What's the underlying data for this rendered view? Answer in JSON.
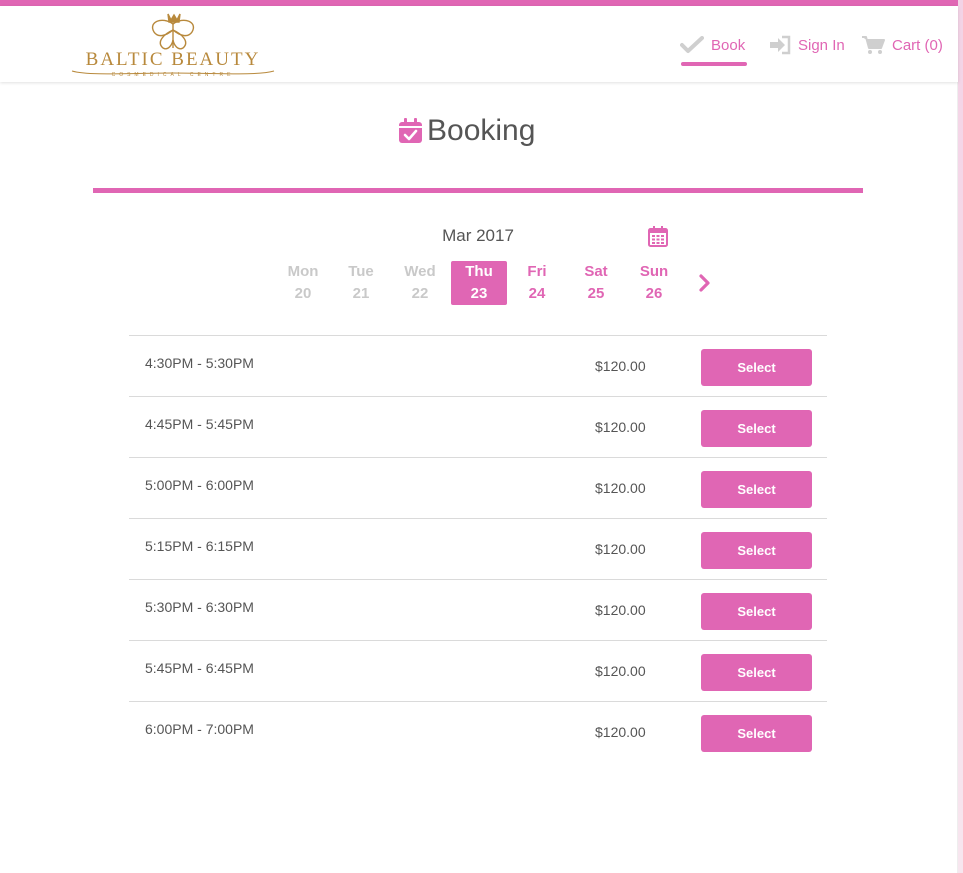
{
  "brand": {
    "name": "BALTIC BEAUTY",
    "tagline": "COSMEDICAL CENTRE",
    "logo_color": "#b8893c"
  },
  "colors": {
    "accent": "#e066b4",
    "muted_day": "#c9c9c9",
    "text": "#555555"
  },
  "nav": {
    "book": {
      "label": "Book",
      "icon": "check-icon"
    },
    "signin": {
      "label": "Sign In",
      "icon": "sign-in-icon"
    },
    "cart": {
      "label": "Cart (0)",
      "icon": "cart-icon"
    }
  },
  "page": {
    "title": "Booking",
    "title_icon": "calendar-check-icon"
  },
  "calendar": {
    "month": "Mar 2017",
    "picker_icon": "calendar-icon",
    "next_icon": "chevron-right-icon",
    "days": [
      {
        "dow": "Mon",
        "date": "20",
        "state": "past"
      },
      {
        "dow": "Tue",
        "date": "21",
        "state": "past"
      },
      {
        "dow": "Wed",
        "date": "22",
        "state": "past"
      },
      {
        "dow": "Thu",
        "date": "23",
        "state": "selected"
      },
      {
        "dow": "Fri",
        "date": "24",
        "state": "future"
      },
      {
        "dow": "Sat",
        "date": "25",
        "state": "future"
      },
      {
        "dow": "Sun",
        "date": "26",
        "state": "future"
      }
    ]
  },
  "slots": [
    {
      "time": "4:30PM - 5:30PM",
      "price": "$120.00",
      "button": "Select"
    },
    {
      "time": "4:45PM - 5:45PM",
      "price": "$120.00",
      "button": "Select"
    },
    {
      "time": "5:00PM - 6:00PM",
      "price": "$120.00",
      "button": "Select"
    },
    {
      "time": "5:15PM - 6:15PM",
      "price": "$120.00",
      "button": "Select"
    },
    {
      "time": "5:30PM - 6:30PM",
      "price": "$120.00",
      "button": "Select"
    },
    {
      "time": "5:45PM - 6:45PM",
      "price": "$120.00",
      "button": "Select"
    },
    {
      "time": "6:00PM - 7:00PM",
      "price": "$120.00",
      "button": "Select"
    }
  ]
}
